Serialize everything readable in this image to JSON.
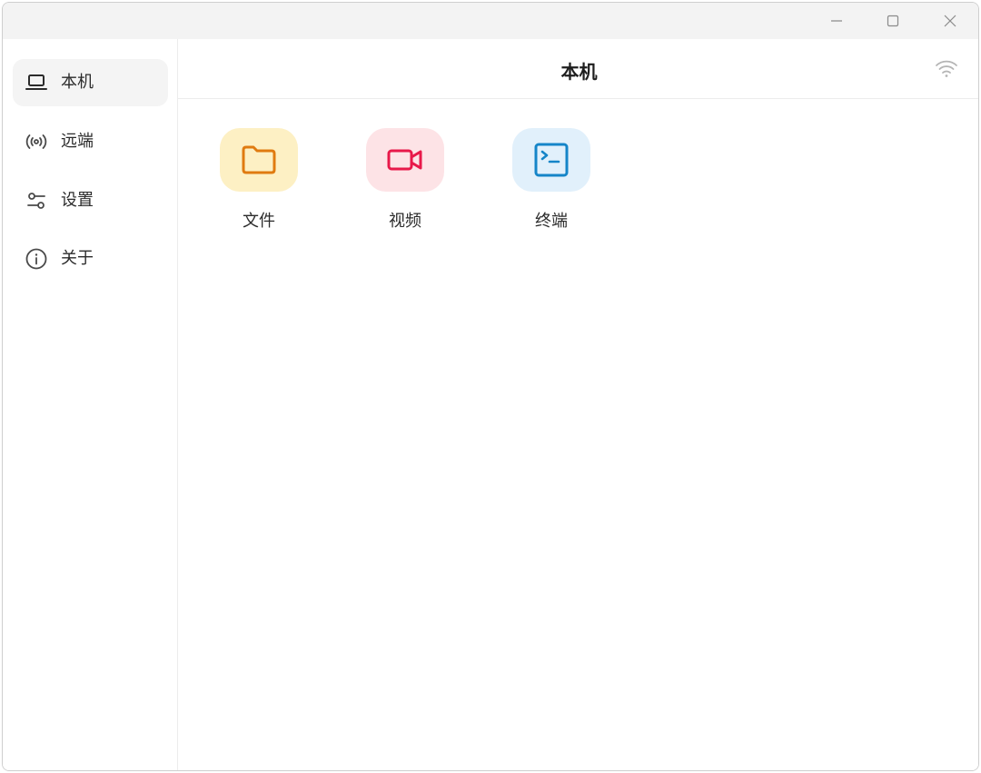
{
  "window": {
    "controls": {
      "minimize_icon": "minimize-icon",
      "maximize_icon": "maximize-icon",
      "close_icon": "close-icon"
    }
  },
  "sidebar": {
    "items": [
      {
        "label": "本机",
        "icon": "laptop-icon",
        "active": true
      },
      {
        "label": "远端",
        "icon": "broadcast-icon",
        "active": false
      },
      {
        "label": "设置",
        "icon": "settings-sliders-icon",
        "active": false
      },
      {
        "label": "关于",
        "icon": "info-icon",
        "active": false
      }
    ]
  },
  "header": {
    "title": "本机",
    "status_icon": "wifi-icon"
  },
  "tiles": [
    {
      "label": "文件",
      "icon": "folder-icon",
      "bg": "#fdf0c4",
      "fg": "#e07b10"
    },
    {
      "label": "视频",
      "icon": "video-camera-icon",
      "bg": "#fde3e6",
      "fg": "#e8194a"
    },
    {
      "label": "终端",
      "icon": "terminal-icon",
      "bg": "#e1f0fb",
      "fg": "#1585c8"
    }
  ],
  "colors": {
    "titlebar_bg": "#f3f3f3",
    "active_nav_bg": "#f4f4f4",
    "text": "#2b2b2b"
  }
}
